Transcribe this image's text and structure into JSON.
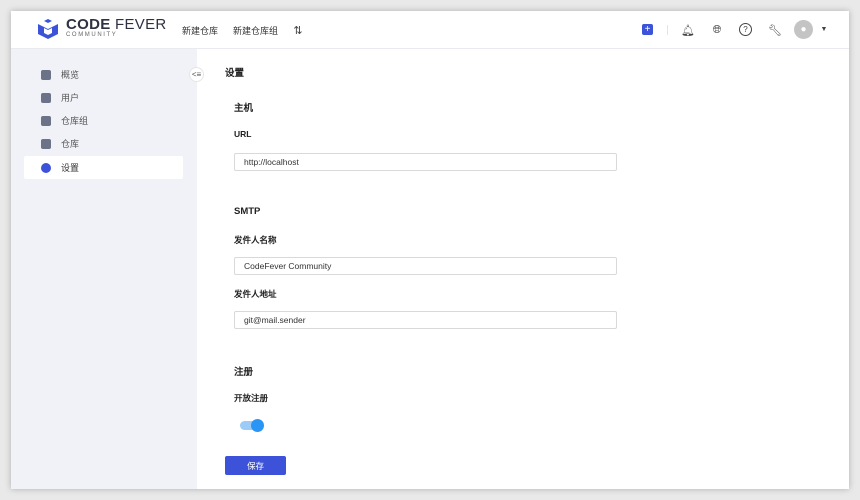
{
  "header": {
    "logo_main": "CODE",
    "logo_main2": "FEVER",
    "logo_sub": "COMMUNITY",
    "nav": [
      "新建仓库",
      "新建仓库组"
    ],
    "icons": [
      "pull-request-icon",
      "plus-icon",
      "bell-icon",
      "globe-icon",
      "help-icon",
      "wrench-icon",
      "avatar-icon",
      "caret-down-icon"
    ]
  },
  "sidebar": {
    "items": [
      {
        "label": "概览",
        "icon": "dashboard-icon"
      },
      {
        "label": "用户",
        "icon": "users-icon"
      },
      {
        "label": "仓库组",
        "icon": "layers-icon"
      },
      {
        "label": "仓库",
        "icon": "box-icon"
      },
      {
        "label": "设置",
        "icon": "gear-icon",
        "active": true
      }
    ]
  },
  "main": {
    "title": "设置",
    "host": {
      "heading": "主机",
      "url_label": "URL",
      "url_value": "http://localhost"
    },
    "smtp": {
      "heading": "SMTP",
      "sender_name_label": "发件人名称",
      "sender_name_value": "CodeFever Community",
      "sender_addr_label": "发件人地址",
      "sender_addr_value": "git@mail.sender"
    },
    "register": {
      "heading": "注册",
      "open_label": "开放注册",
      "open_enabled": true
    },
    "save_label": "保存"
  },
  "colors": {
    "accent": "#3b52d9",
    "toggle": "#2b95f5",
    "sidebar_bg": "#f0f2f7"
  }
}
